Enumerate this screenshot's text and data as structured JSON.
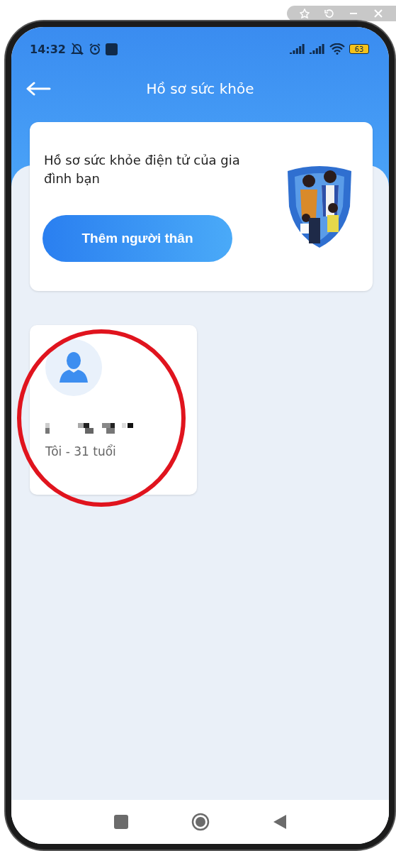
{
  "status_bar": {
    "time": "14:32",
    "battery": "63"
  },
  "header": {
    "title": "Hồ sơ sức khỏe"
  },
  "banner": {
    "text": "Hồ sơ sức khỏe điện tử của gia đình bạn",
    "button": "Thêm người thân"
  },
  "profiles": [
    {
      "name_redacted": true,
      "subtitle": "Tôi - 31 tuổi",
      "circled": true
    }
  ]
}
